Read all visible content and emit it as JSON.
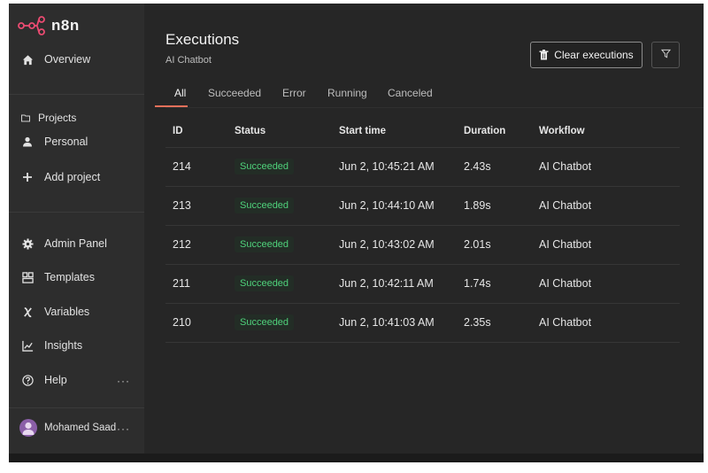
{
  "app": {
    "name": "n8n",
    "accent": "#e8705a",
    "success": "#4fd17b"
  },
  "sidebar": {
    "overview": "Overview",
    "projects": "Projects",
    "personal": "Personal",
    "add_project": "Add project",
    "admin_panel": "Admin Panel",
    "templates": "Templates",
    "variables": "Variables",
    "insights": "Insights",
    "help": "Help",
    "more_glyph": "···",
    "user": {
      "name": "Mohamed Saad"
    }
  },
  "header": {
    "title": "Executions",
    "subtitle": "AI Chatbot",
    "clear_label": "Clear executions"
  },
  "tabs": [
    "All",
    "Succeeded",
    "Error",
    "Running",
    "Canceled"
  ],
  "active_tab": "All",
  "table": {
    "columns": [
      "ID",
      "Status",
      "Start time",
      "Duration",
      "Workflow"
    ],
    "rows": [
      {
        "id": "214",
        "status": "Succeeded",
        "start": "Jun 2, 10:45:21 AM",
        "duration": "2.43s",
        "workflow": "AI Chatbot"
      },
      {
        "id": "213",
        "status": "Succeeded",
        "start": "Jun 2, 10:44:10 AM",
        "duration": "1.89s",
        "workflow": "AI Chatbot"
      },
      {
        "id": "212",
        "status": "Succeeded",
        "start": "Jun 2, 10:43:02 AM",
        "duration": "2.01s",
        "workflow": "AI Chatbot"
      },
      {
        "id": "211",
        "status": "Succeeded",
        "start": "Jun 2, 10:42:11 AM",
        "duration": "1.74s",
        "workflow": "AI Chatbot"
      },
      {
        "id": "210",
        "status": "Succeeded",
        "start": "Jun 2, 10:41:03 AM",
        "duration": "2.35s",
        "workflow": "AI Chatbot"
      }
    ]
  }
}
